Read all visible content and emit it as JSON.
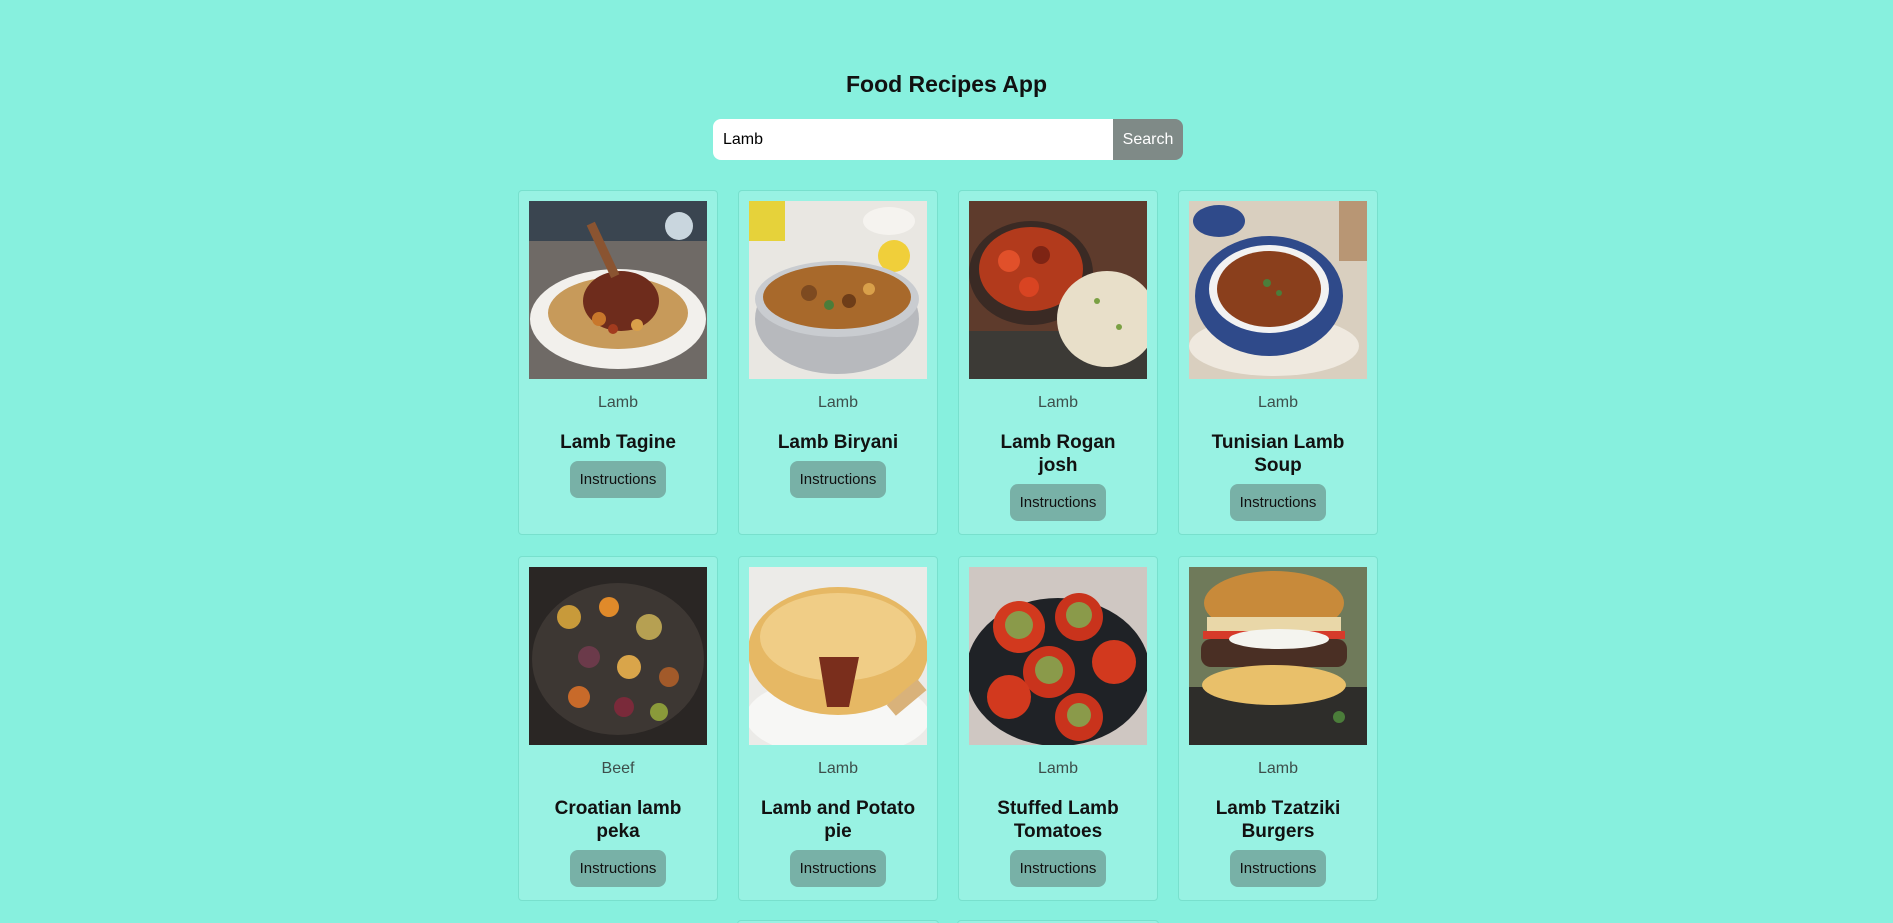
{
  "app": {
    "title": "Food Recipes App"
  },
  "search": {
    "value": "Lamb",
    "button_label": "Search"
  },
  "meals": [
    {
      "category": "Lamb",
      "name": "Lamb Tagine",
      "button_label": "Instructions",
      "thumb": "tagine"
    },
    {
      "category": "Lamb",
      "name": "Lamb Biryani",
      "button_label": "Instructions",
      "thumb": "biryani"
    },
    {
      "category": "Lamb",
      "name": "Lamb Rogan josh",
      "button_label": "Instructions",
      "thumb": "rogan"
    },
    {
      "category": "Lamb",
      "name": "Tunisian Lamb Soup",
      "button_label": "Instructions",
      "thumb": "soup"
    },
    {
      "category": "Beef",
      "name": "Croatian lamb peka",
      "button_label": "Instructions",
      "thumb": "peka"
    },
    {
      "category": "Lamb",
      "name": "Lamb and Potato pie",
      "button_label": "Instructions",
      "thumb": "pie"
    },
    {
      "category": "Lamb",
      "name": "Stuffed Lamb Tomatoes",
      "button_label": "Instructions",
      "thumb": "tomatoes"
    },
    {
      "category": "Lamb",
      "name": "Lamb Tzatziki Burgers",
      "button_label": "Instructions",
      "thumb": "burger"
    }
  ],
  "colors": {
    "background": "#87f0de",
    "card": "#98f2e3",
    "button": "#78b1a7",
    "search_button": "#7f8a87"
  }
}
